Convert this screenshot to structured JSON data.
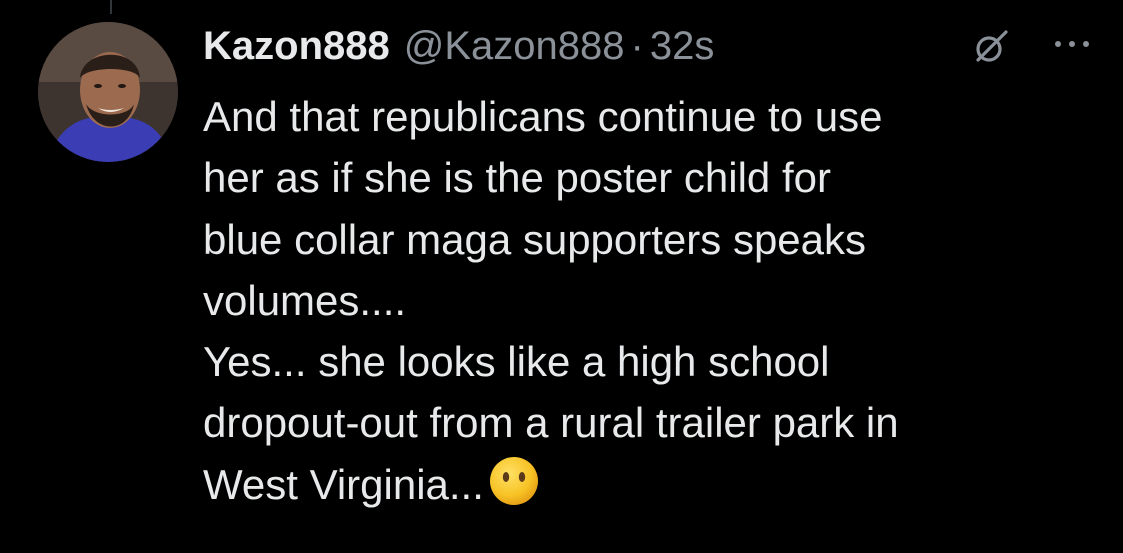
{
  "tweet": {
    "author": {
      "display_name": "Kazon888",
      "handle": "@Kazon888"
    },
    "separator": "·",
    "timestamp": "32s",
    "body_lines": [
      "And that republicans continue to use",
      "her as if she is the poster child for",
      "blue collar maga supporters speaks",
      "volumes....",
      "Yes... she looks like a high school",
      "dropout-out from a rural trailer park in",
      "West Virginia..."
    ],
    "emoji": "face-without-mouth-emoji",
    "icons": {
      "grok": "grok-icon",
      "more": "more-options-icon"
    }
  },
  "colors": {
    "background": "#000000",
    "primary_text": "#e7e9ea",
    "secondary_text": "#8b9198"
  }
}
